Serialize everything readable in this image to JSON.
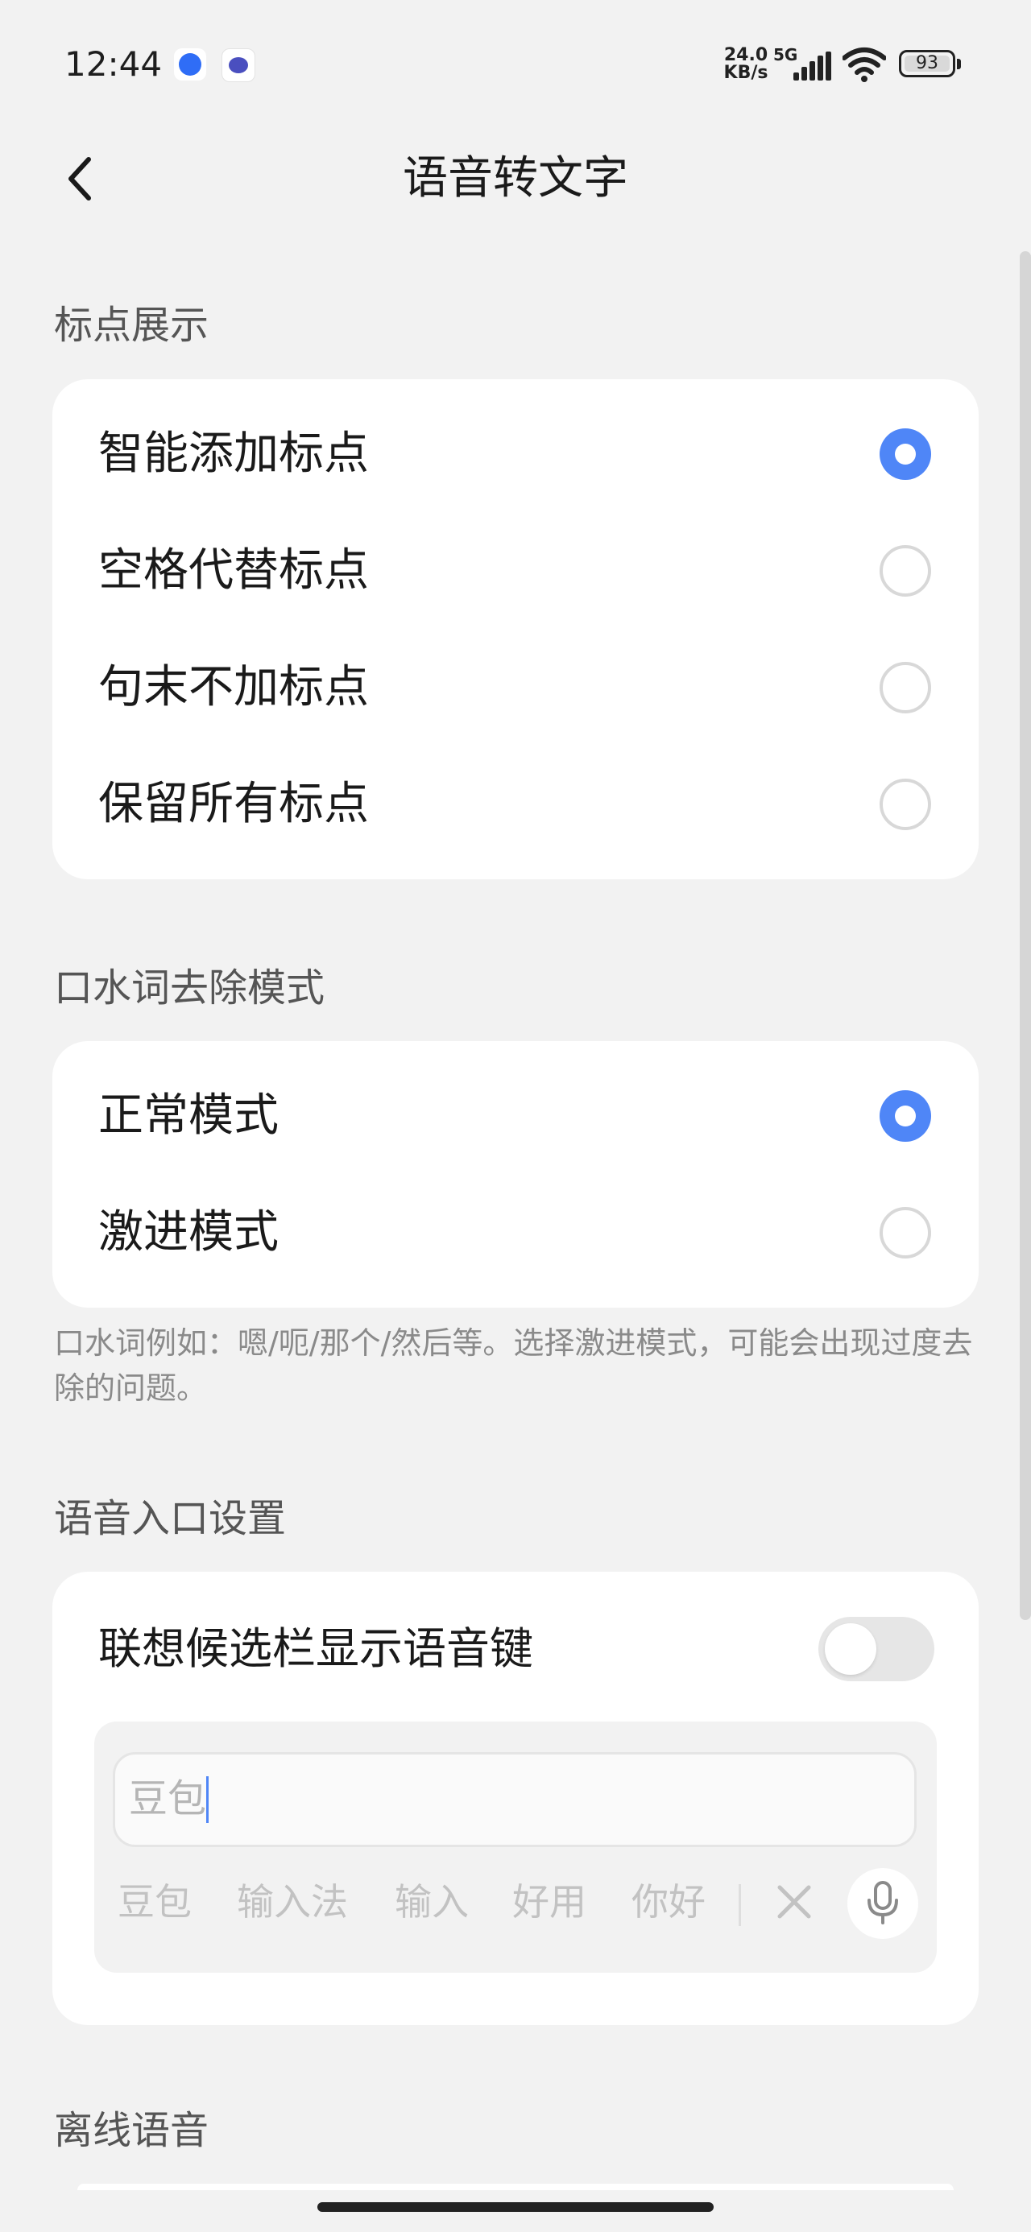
{
  "status_bar": {
    "time": "12:44",
    "net_speed": "24.0",
    "net_speed_unit": "KB/s",
    "network": "5G",
    "battery": "93",
    "icons": [
      "app-notification-icon",
      "app-notification-icon",
      "signal-icon",
      "wifi-icon",
      "battery-icon"
    ]
  },
  "header": {
    "title": "语音转文字",
    "back_icon": "chevron-left-icon"
  },
  "punctuation": {
    "section_title": "标点展示",
    "options": [
      {
        "label": "智能添加标点",
        "selected": true
      },
      {
        "label": "空格代替标点",
        "selected": false
      },
      {
        "label": "句末不加标点",
        "selected": false
      },
      {
        "label": "保留所有标点",
        "selected": false
      }
    ]
  },
  "filler_words": {
    "section_title": "口水词去除模式",
    "options": [
      {
        "label": "正常模式",
        "selected": true
      },
      {
        "label": "激进模式",
        "selected": false
      }
    ],
    "hint": "口水词例如：嗯/呃/那个/然后等。选择激进模式，可能会出现过度去除的问题。"
  },
  "voice_entry": {
    "section_title": "语音入口设置",
    "toggle_label": "联想候选栏显示语音键",
    "toggle_on": false,
    "preview": {
      "input_text": "豆包",
      "candidates": [
        "豆包",
        "输入法",
        "输入",
        "好用",
        "你好"
      ]
    }
  },
  "offline_voice": {
    "section_title": "离线语音"
  },
  "colors": {
    "accent": "#4f86f7",
    "background": "#f2f2f2",
    "card": "#ffffff"
  }
}
